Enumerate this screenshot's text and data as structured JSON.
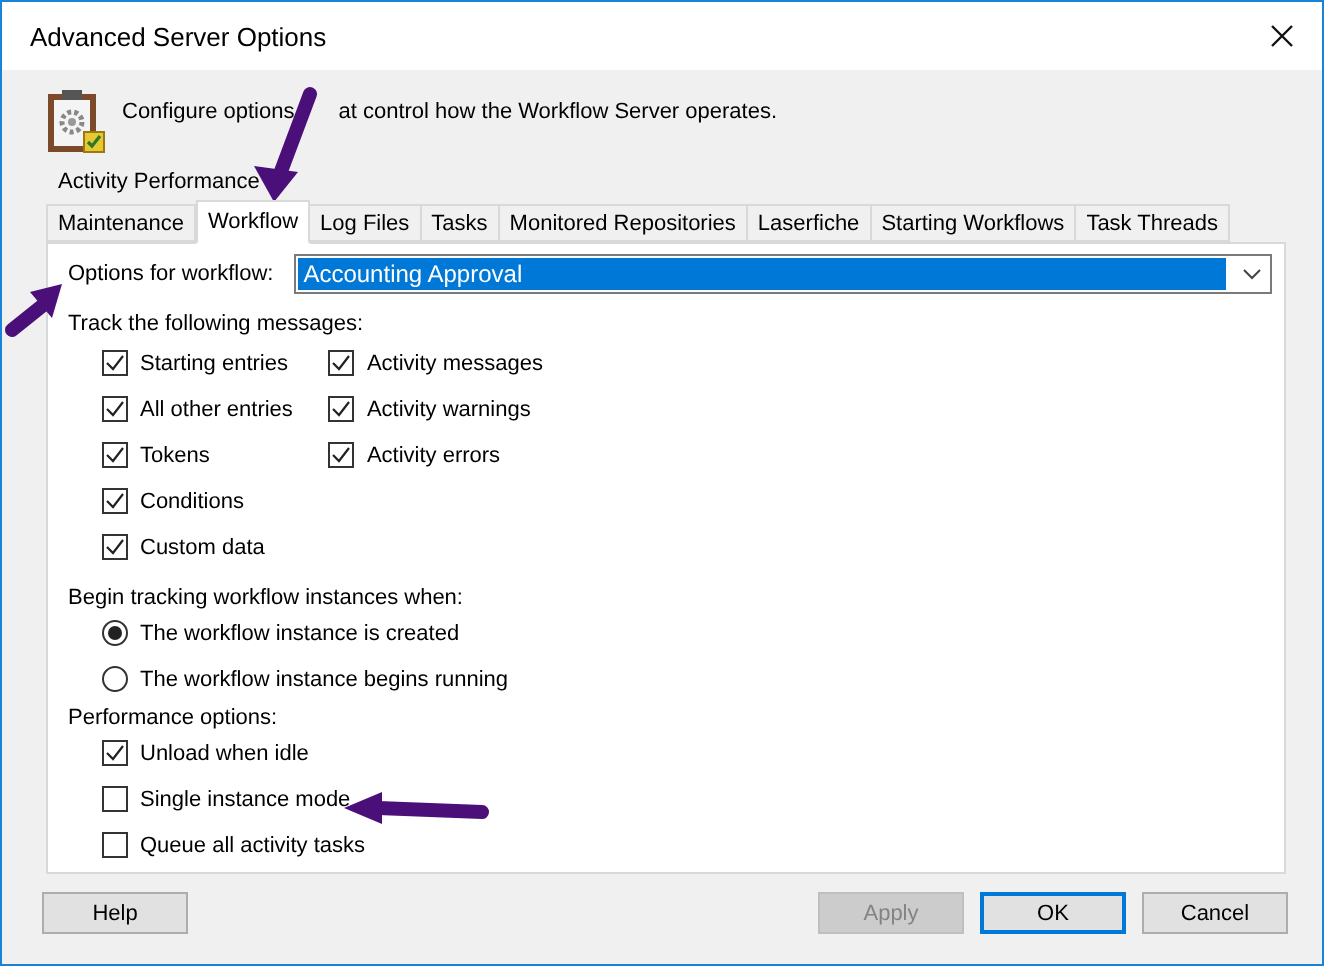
{
  "window": {
    "title": "Advanced Server Options"
  },
  "header": {
    "texts": [
      "Configure options",
      "at control how the Workflow Server operates."
    ]
  },
  "tab_rows": [
    [
      {
        "label": "Activity Performance",
        "selected": false
      }
    ],
    [
      {
        "label": "Maintenance",
        "selected": false
      },
      {
        "label": "Workflow",
        "selected": true
      },
      {
        "label": "Log Files",
        "selected": false
      },
      {
        "label": "Tasks",
        "selected": false
      },
      {
        "label": "Monitored Repositories",
        "selected": false
      },
      {
        "label": "Laserfiche",
        "selected": false
      },
      {
        "label": "Starting Workflows",
        "selected": false
      },
      {
        "label": "Task Threads",
        "selected": false
      }
    ]
  ],
  "workflow_select": {
    "label": "Options for workflow:",
    "value": "Accounting Approval"
  },
  "track_messages": {
    "title": "Track the following messages:",
    "columns": [
      [
        {
          "label": "Starting entries",
          "checked": true
        },
        {
          "label": "All other entries",
          "checked": true
        },
        {
          "label": "Tokens",
          "checked": true
        },
        {
          "label": "Conditions",
          "checked": true
        },
        {
          "label": "Custom data",
          "checked": true
        }
      ],
      [
        {
          "label": "Activity messages",
          "checked": true
        },
        {
          "label": "Activity warnings",
          "checked": true
        },
        {
          "label": "Activity errors",
          "checked": true
        }
      ]
    ]
  },
  "begin_tracking": {
    "title": "Begin tracking workflow instances when:",
    "options": [
      {
        "label": "The workflow instance is created",
        "selected": true
      },
      {
        "label": "The workflow instance begins running",
        "selected": false
      }
    ]
  },
  "performance": {
    "title": "Performance options:",
    "options": [
      {
        "label": "Unload when idle",
        "checked": true
      },
      {
        "label": "Single instance mode",
        "checked": false
      },
      {
        "label": "Queue all activity tasks",
        "checked": false
      }
    ]
  },
  "buttons": [
    {
      "label": "Help",
      "disabled": false,
      "default": false
    },
    {
      "label": "Apply",
      "disabled": true,
      "default": false
    },
    {
      "label": "OK",
      "disabled": false,
      "default": true
    },
    {
      "label": "Cancel",
      "disabled": false,
      "default": false
    }
  ]
}
